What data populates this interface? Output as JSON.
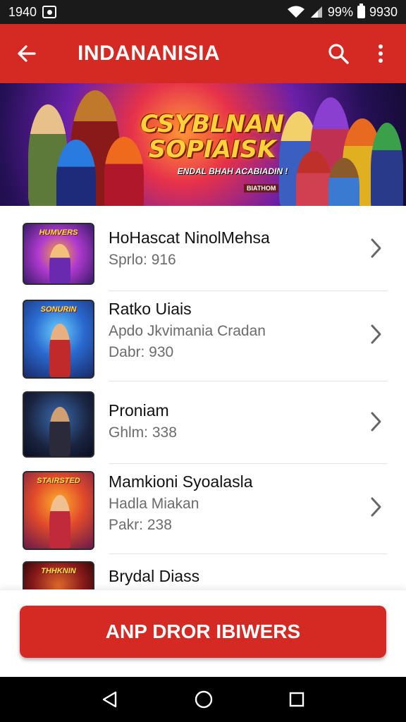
{
  "status_bar": {
    "time": "1940",
    "battery_text": "%",
    "signal_text": "99",
    "clock_right": "9930",
    "icons": [
      "notification-icon",
      "wifi-icon",
      "signal-icon",
      "battery-icon"
    ]
  },
  "app_bar": {
    "title": "INDANANISIA",
    "back_icon": "arrow-back-icon",
    "search_icon": "search-icon",
    "more_icon": "more-vert-icon",
    "color": "#d42a23"
  },
  "banner": {
    "title_line1": "CSYBLNAN",
    "title_line2": "SOPIAISK",
    "subtitle": "ENDAL BHAH ACABIADIN !",
    "tag": "BIATHOM"
  },
  "list": {
    "items": [
      {
        "title": "HoHascat NinolMehsa",
        "line1": "Sprlo: 916",
        "line2": "",
        "thumb_label": "HUMVERS"
      },
      {
        "title": "Ratko Uiais",
        "line1": "Apdo Jkvimania Cradan",
        "line2": "Dabr: 930",
        "thumb_label": "SONURIN"
      },
      {
        "title": "Proniam",
        "line1": "Ghlm: 338",
        "line2": "",
        "thumb_label": ""
      },
      {
        "title": "Mamkioni Syoalasla",
        "line1": "Hadla Miakan",
        "line2": "Pakr: 238",
        "thumb_label": "STAIRSTED"
      },
      {
        "title": "Brydal Diass",
        "line1": "",
        "line2": "",
        "thumb_label": "THHKNIN"
      }
    ]
  },
  "cta": {
    "label": "ANP DROR IBIWERS"
  },
  "nav": {
    "back_icon": "nav-back-icon",
    "home_icon": "nav-home-icon",
    "recents_icon": "nav-recents-icon"
  }
}
